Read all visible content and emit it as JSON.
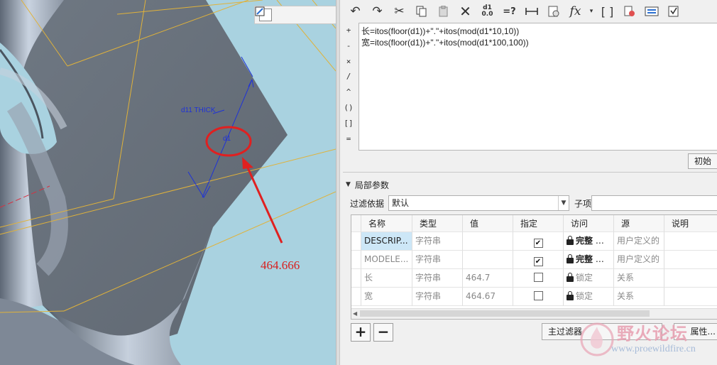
{
  "viewport": {
    "dim_label_thick": "d11 THICK",
    "dim_label_d1": "d1",
    "callout_value": "464.666",
    "toolbar_icons": [
      "zoom-fit-icon",
      "zoom-in-icon",
      "zoom-out-icon",
      "repaint-icon"
    ],
    "colors": {
      "background": "#a9d2e0",
      "annotation": "#e02020",
      "dimension": "#1e32d8",
      "datum": "#e0b23a"
    }
  },
  "relations": {
    "toolbar_icons": [
      "undo-icon",
      "redo-icon",
      "cut-icon",
      "copy-icon",
      "paste-icon",
      "delete-icon",
      "dimension-toggle-icon",
      "evaluate-icon",
      "measure-icon",
      "sort-icon",
      "function-icon",
      "brackets-icon",
      "verify-icon",
      "units-icon",
      "execute-icon"
    ],
    "operators": [
      "+",
      "-",
      "×",
      "/",
      "^",
      "()",
      "[]",
      "="
    ],
    "lines": [
      "长=itos(floor(d1))+\".\"+itos(mod(d1*10,10))",
      "宽=itos(floor(d1))+\".\"+itos(mod(d1*100,100))"
    ],
    "init_button": "初始"
  },
  "local_params": {
    "section_title": "局部参数",
    "filter_label": "过滤依据",
    "filter_value": "默认",
    "sub_label": "子项",
    "columns": [
      "名称",
      "类型",
      "值",
      "指定",
      "访问",
      "源",
      "说明"
    ],
    "rows": [
      {
        "name": "DESCRIP...",
        "type": "字符串",
        "value": "",
        "designate": "✔",
        "access": "完整",
        "source": "用户定义的",
        "note": ""
      },
      {
        "name": "MODELE...",
        "type": "字符串",
        "value": "",
        "designate": "✔",
        "access": "完整",
        "source": "用户定义的",
        "note": ""
      },
      {
        "name": "长",
        "type": "字符串",
        "value": "464.7",
        "designate": "",
        "access": "锁定",
        "source": "关系",
        "note": ""
      },
      {
        "name": "宽",
        "type": "字符串",
        "value": "464.67",
        "designate": "",
        "access": "锁定",
        "source": "关系",
        "note": ""
      }
    ],
    "add_label": "+",
    "remove_label": "−",
    "master_filter": "主过滤器",
    "properties": "属性..."
  },
  "watermark": {
    "title": "野火论坛",
    "url": "www.proewildfire.cn"
  }
}
